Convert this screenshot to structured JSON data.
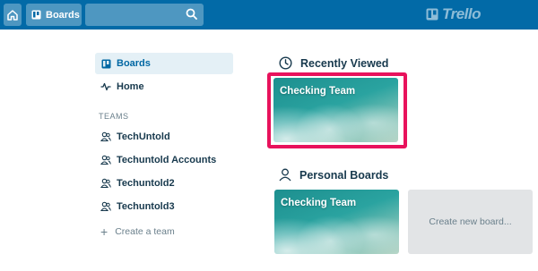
{
  "header": {
    "boards_label": "Boards",
    "search_value": "",
    "logo_text": "Trello"
  },
  "sidebar": {
    "items": [
      {
        "label": "Boards",
        "icon": "board-icon",
        "active": true
      },
      {
        "label": "Home",
        "icon": "activity-icon",
        "active": false
      }
    ],
    "teams_heading": "TEAMS",
    "teams": [
      {
        "label": "TechUntold"
      },
      {
        "label": "Techuntold Accounts"
      },
      {
        "label": "Techuntold2"
      },
      {
        "label": "Techuntold3"
      }
    ],
    "create_team_label": "Create a team"
  },
  "main": {
    "recent": {
      "title": "Recently Viewed",
      "icon": "clock-icon",
      "boards": [
        {
          "name": "Checking Team"
        }
      ]
    },
    "personal": {
      "title": "Personal Boards",
      "icon": "person-icon",
      "boards": [
        {
          "name": "Checking Team"
        }
      ],
      "create_label": "Create new board..."
    }
  },
  "colors": {
    "header_bg": "#026aa7",
    "highlight": "#e8125c",
    "active_nav_bg": "#e4f0f6",
    "active_nav_text": "#0067a3"
  }
}
